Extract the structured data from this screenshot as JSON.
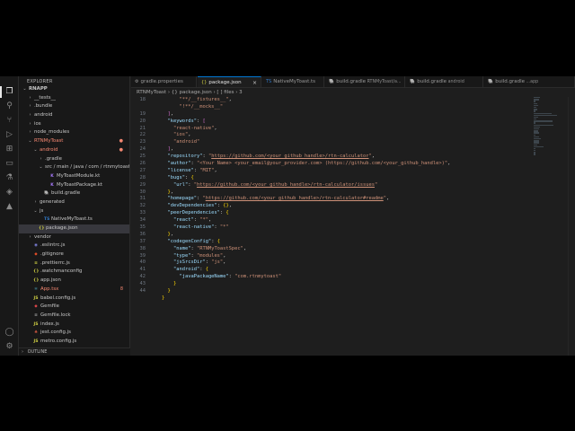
{
  "sidebar": {
    "title": "EXPLORER",
    "outline_label": "OUTLINE",
    "tree": [
      {
        "name": "RNAPP",
        "depth": 0,
        "chev": "⌄",
        "icon": "",
        "bold": true
      },
      {
        "name": "__tests__",
        "depth": 1,
        "chev": "›",
        "icon": ""
      },
      {
        "name": ".bundle",
        "depth": 1,
        "chev": "›",
        "icon": ""
      },
      {
        "name": "android",
        "depth": 1,
        "chev": "›",
        "icon": ""
      },
      {
        "name": "ios",
        "depth": 1,
        "chev": "›",
        "icon": ""
      },
      {
        "name": "node_modules",
        "depth": 1,
        "chev": "›",
        "icon": ""
      },
      {
        "name": "RTNMyToast",
        "depth": 1,
        "chev": "⌄",
        "icon": "",
        "red": true,
        "badge": "●"
      },
      {
        "name": "android",
        "depth": 2,
        "chev": "⌄",
        "icon": "",
        "red": true,
        "badge": "●"
      },
      {
        "name": ".gradle",
        "depth": 3,
        "chev": "›",
        "icon": ""
      },
      {
        "name": "src / main / java / com / rtnmytoast",
        "depth": 3,
        "chev": "⌄",
        "icon": ""
      },
      {
        "name": "MyToastModule.kt",
        "depth": 4,
        "chev": "",
        "icon": "K",
        "iconColor": "#a97bff"
      },
      {
        "name": "MyToastPackage.kt",
        "depth": 4,
        "chev": "",
        "icon": "K",
        "iconColor": "#a97bff"
      },
      {
        "name": "build.gradle",
        "depth": 3,
        "chev": "",
        "icon": "🐘",
        "iconColor": "#4db6ac"
      },
      {
        "name": "generated",
        "depth": 2,
        "chev": "›",
        "icon": ""
      },
      {
        "name": "js",
        "depth": 2,
        "chev": "⌄",
        "icon": ""
      },
      {
        "name": "NativeMyToast.ts",
        "depth": 3,
        "chev": "",
        "icon": "TS",
        "iconColor": "#3178c6"
      },
      {
        "name": "package.json",
        "depth": 2,
        "chev": "",
        "icon": "{}",
        "iconColor": "#cbcb41",
        "selected": true
      },
      {
        "name": "vendor",
        "depth": 1,
        "chev": "›",
        "icon": ""
      },
      {
        "name": ".eslintrc.js",
        "depth": 1,
        "chev": "",
        "icon": "◉",
        "iconColor": "#7b7fd8"
      },
      {
        "name": ".gitignore",
        "depth": 1,
        "chev": "",
        "icon": "◆",
        "iconColor": "#e44d26"
      },
      {
        "name": ".prettierrc.js",
        "depth": 1,
        "chev": "",
        "icon": "≡",
        "iconColor": "#cbcb41"
      },
      {
        "name": ".watchmanconfig",
        "depth": 1,
        "chev": "",
        "icon": "{}",
        "iconColor": "#cbcb41"
      },
      {
        "name": "app.json",
        "depth": 1,
        "chev": "",
        "icon": "{}",
        "iconColor": "#cbcb41"
      },
      {
        "name": "App.tsx",
        "depth": 1,
        "chev": "",
        "icon": "⚛",
        "iconColor": "#61dafb",
        "red": true,
        "badge": "8"
      },
      {
        "name": "babel.config.js",
        "depth": 1,
        "chev": "",
        "icon": "JS",
        "iconColor": "#cbcb41"
      },
      {
        "name": "Gemfile",
        "depth": 1,
        "chev": "",
        "icon": "◆",
        "iconColor": "#e0464a"
      },
      {
        "name": "Gemfile.lock",
        "depth": 1,
        "chev": "",
        "icon": "≡",
        "iconColor": "#9a9a9a"
      },
      {
        "name": "index.js",
        "depth": 1,
        "chev": "",
        "icon": "JS",
        "iconColor": "#cbcb41"
      },
      {
        "name": "jest.config.js",
        "depth": 1,
        "chev": "",
        "icon": "♣",
        "iconColor": "#c9543e"
      },
      {
        "name": "metro.config.js",
        "depth": 1,
        "chev": "",
        "icon": "JS",
        "iconColor": "#cbcb41"
      }
    ]
  },
  "tabs": [
    {
      "label": "gradle.properties",
      "icon": "⚙",
      "iconColor": "#9a9a9a",
      "desc": ""
    },
    {
      "label": "package.json",
      "icon": "{}",
      "iconColor": "#cbcb41",
      "desc": "",
      "active": true,
      "close": "×"
    },
    {
      "label": "NativeMyToast.ts",
      "icon": "TS",
      "iconColor": "#3178c6",
      "desc": ""
    },
    {
      "label": "build.gradle",
      "icon": "🐘",
      "iconColor": "#4db6ac",
      "desc": "RTNMyToast/a..."
    },
    {
      "label": "build.gradle",
      "icon": "🐘",
      "iconColor": "#4db6ac",
      "desc": "android"
    },
    {
      "label": "build.gradle",
      "icon": "🐘",
      "iconColor": "#4db6ac",
      "desc": "...app"
    }
  ],
  "breadcrumb": {
    "text": "RTNMyToast  ›  {} package.json  ›  [ ] files  ›  3"
  },
  "code": {
    "lines": [
      {
        "n": "18",
        "src": "      \"**/__fixtures__\","
      },
      {
        "n": "",
        "src": "      \"!**/__mocks__\""
      },
      {
        "n": "19",
        "src": "  ],"
      },
      {
        "n": "20",
        "src": "  \"keywords\": ["
      },
      {
        "n": "21",
        "src": "    \"react-native\","
      },
      {
        "n": "22",
        "src": "    \"ios\","
      },
      {
        "n": "23",
        "src": "    \"android\""
      },
      {
        "n": "24",
        "src": "  ],"
      },
      {
        "n": "25",
        "src": "  \"repository\": \"https://github.com/<your_github_handle>/rtn-calculator\","
      },
      {
        "n": "26",
        "src": "  \"author\": \"<Your Name> <your_email@your_provider.com> (https://github.com/<your_github_handle>)\","
      },
      {
        "n": "27",
        "src": "  \"license\": \"MIT\","
      },
      {
        "n": "28",
        "src": "  \"bugs\": {"
      },
      {
        "n": "29",
        "src": "    \"url\": \"https://github.com/<your_github_handle>/rtn-calculator/issues\""
      },
      {
        "n": "30",
        "src": "  },"
      },
      {
        "n": "31",
        "src": "  \"homepage\": \"https://github.com/<your_github_handle>/rtn-calculator#readme\","
      },
      {
        "n": "32",
        "src": "  \"devDependencies\": {},"
      },
      {
        "n": "33",
        "src": "  \"peerDependencies\": {"
      },
      {
        "n": "34",
        "src": "    \"react\": \"*\","
      },
      {
        "n": "35",
        "src": "    \"react-native\": \"*\""
      },
      {
        "n": "36",
        "src": "  },"
      },
      {
        "n": "37",
        "src": "  \"codegenConfig\": {"
      },
      {
        "n": "38",
        "src": "    \"name\": \"RTNMyToastSpec\","
      },
      {
        "n": "39",
        "src": "    \"type\": \"modules\","
      },
      {
        "n": "40",
        "src": "    \"jsSrcsDir\": \"js\","
      },
      {
        "n": "41",
        "src": "    \"android\": {"
      },
      {
        "n": "42",
        "src": "      \"javaPackageName\": \"com.rtnmytoast\""
      },
      {
        "n": "43",
        "src": "    }"
      },
      {
        "n": "44",
        "src": "  }"
      },
      {
        "n": "",
        "src": "}"
      },
      {
        "n": "",
        "src": ""
      }
    ]
  },
  "colors": {
    "accent": "#0078d4",
    "editor_bg": "#1e1e1e",
    "sidebar_bg": "#181818",
    "key": "#9cdcfe",
    "string": "#ce9178",
    "modified": "#f48771"
  }
}
